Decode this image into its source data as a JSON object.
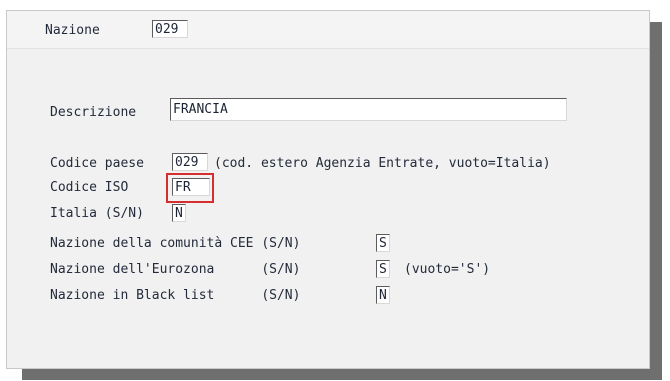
{
  "form": {
    "nazione": {
      "label": "Nazione",
      "value": "029"
    },
    "descrizione": {
      "label": "Descrizione",
      "value": "FRANCIA"
    },
    "codice_paese": {
      "label": "Codice paese",
      "value": "029",
      "note": "(cod. estero Agenzia Entrate, vuoto=Italia)"
    },
    "codice_iso": {
      "label": "Codice ISO",
      "value": "FR"
    },
    "italia": {
      "label": "Italia (S/N)",
      "value": "N"
    },
    "comunita_cee": {
      "label": "Nazione della comunità CEE (S/N)",
      "value": "S"
    },
    "eurozona": {
      "label": "Nazione dell'Eurozona      (S/N)",
      "value": "S",
      "note": "(vuoto='S')"
    },
    "black_list": {
      "label": "Nazione in Black list      (S/N)",
      "value": "N"
    }
  },
  "colors": {
    "panel": "#f1f1f1",
    "shadow": "#6f6f6f",
    "highlight": "#d62e2e",
    "text": "#232a3a"
  }
}
